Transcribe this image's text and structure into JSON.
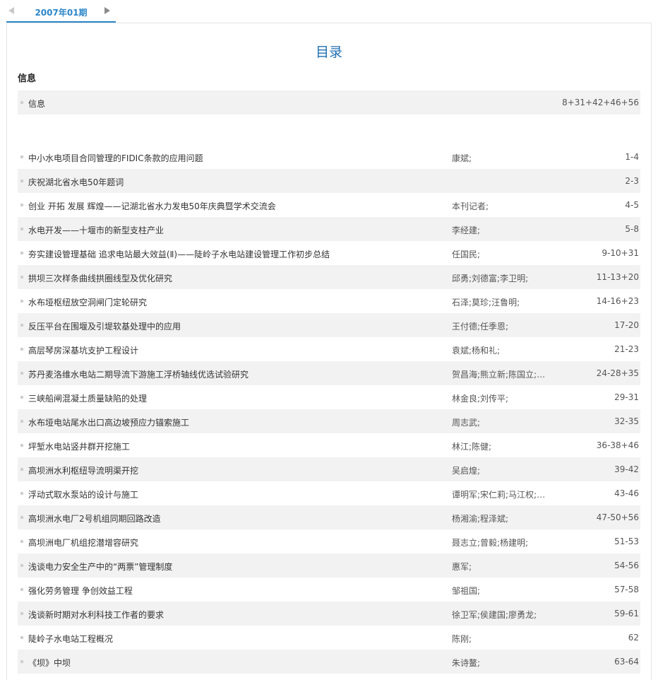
{
  "tabs": {
    "active_label": "2007年01期"
  },
  "toc_title": "目录",
  "section_title": "信息",
  "info_row": {
    "title": "信息",
    "author": "",
    "pages": "8+31+42+46+56"
  },
  "articles": [
    {
      "title": "中小水电项目合同管理的FIDIC条款的应用问题",
      "author": "康斌;",
      "pages": "1-4"
    },
    {
      "title": "庆祝湖北省水电50年题词",
      "author": "",
      "pages": "2-3"
    },
    {
      "title": "创业 开拓 发展 辉煌——记湖北省水力发电50年庆典暨学术交流会",
      "author": "本刊记者;",
      "pages": "4-5"
    },
    {
      "title": "水电开发——十堰市的新型支柱产业",
      "author": "李经建;",
      "pages": "5-8"
    },
    {
      "title": "夯实建设管理基础 追求电站最大效益(Ⅱ)——陡岭子水电站建设管理工作初步总结",
      "author": "任国民;",
      "pages": "9-10+31"
    },
    {
      "title": "拱坝三次样条曲线拱圈线型及优化研究",
      "author": "邱勇;刘德富;李卫明;",
      "pages": "11-13+20"
    },
    {
      "title": "水布垭枢纽放空洞闸门定轮研究",
      "author": "石泽;莫珍;汪鲁明;",
      "pages": "14-16+23"
    },
    {
      "title": "反压平台在围堰及引堤软基处理中的应用",
      "author": "王付德;任季恩;",
      "pages": "17-20"
    },
    {
      "title": "高层琴房深基坑支护工程设计",
      "author": "袁斌;杨和礼;",
      "pages": "21-23"
    },
    {
      "title": "苏丹麦洛维水电站二期导流下游施工浮桥轴线优选试验研究",
      "author": "贺昌海;熊立新;陈国立;…",
      "pages": "24-28+35"
    },
    {
      "title": "三峡船闸混凝土质量缺陷的处理",
      "author": "林金良;刘传平;",
      "pages": "29-31"
    },
    {
      "title": "水布垭电站尾水出口高边坡预应力锚索施工",
      "author": "周志武;",
      "pages": "32-35"
    },
    {
      "title": "坪堑水电站竖井群开挖施工",
      "author": "林江;陈健;",
      "pages": "36-38+46"
    },
    {
      "title": "高坝洲水利枢纽导流明渠开挖",
      "author": "吴启煌;",
      "pages": "39-42"
    },
    {
      "title": "浮动式取水泵站的设计与施工",
      "author": "谭明军;宋仁莉;马江权;…",
      "pages": "43-46"
    },
    {
      "title": "高坝洲水电厂2号机组同期回路改造",
      "author": "杨湘渝;程泽斌;",
      "pages": "47-50+56"
    },
    {
      "title": "高坝洲电厂机组挖潜增容研究",
      "author": "聂志立;曾毅;杨建明;",
      "pages": "51-53"
    },
    {
      "title": "浅谈电力安全生产中的“两票”管理制度",
      "author": "惠军;",
      "pages": "54-56"
    },
    {
      "title": "强化劳务管理 争创效益工程",
      "author": "邹祖国;",
      "pages": "57-58"
    },
    {
      "title": "浅谈新时期对水利科技工作者的要求",
      "author": "徐卫军;侯建国;廖勇龙;",
      "pages": "59-61"
    },
    {
      "title": "陡岭子水电站工程概况",
      "author": "陈刚;",
      "pages": "62"
    },
    {
      "title": "《坝》中坝",
      "author": "朱诗鳌;",
      "pages": "63-64"
    }
  ]
}
